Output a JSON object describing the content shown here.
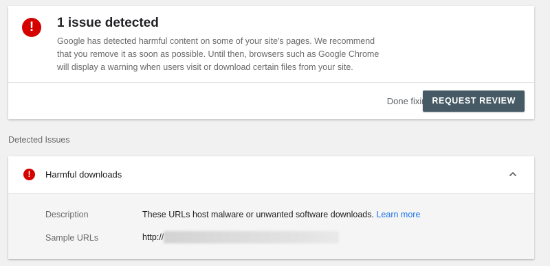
{
  "alert": {
    "icon": "error-icon",
    "icon_glyph": "!",
    "title": "1 issue detected",
    "body": "Google has detected harmful content on some of your site's pages. We recommend that you remove it as soon as possible. Until then, browsers such as Google Chrome will display a warning when users visit or download certain files from your site.",
    "done_fixing": "Done fixing?",
    "request_review_label": "REQUEST REVIEW"
  },
  "section": {
    "label": "Detected Issues"
  },
  "issue": {
    "icon": "error-icon",
    "icon_glyph": "!",
    "title": "Harmful downloads",
    "expanded": true,
    "chevron_icon": "chevron-up-icon",
    "description_label": "Description",
    "description_text": "These URLs host malware or unwanted software downloads.",
    "learn_more_label": "Learn more",
    "sample_urls_label": "Sample URLs",
    "sample_url_prefix": "http://"
  },
  "colors": {
    "error_red": "#d50000",
    "button_bg": "#455a64",
    "link_blue": "#1a73e8",
    "page_bg": "#f1f1f1"
  }
}
